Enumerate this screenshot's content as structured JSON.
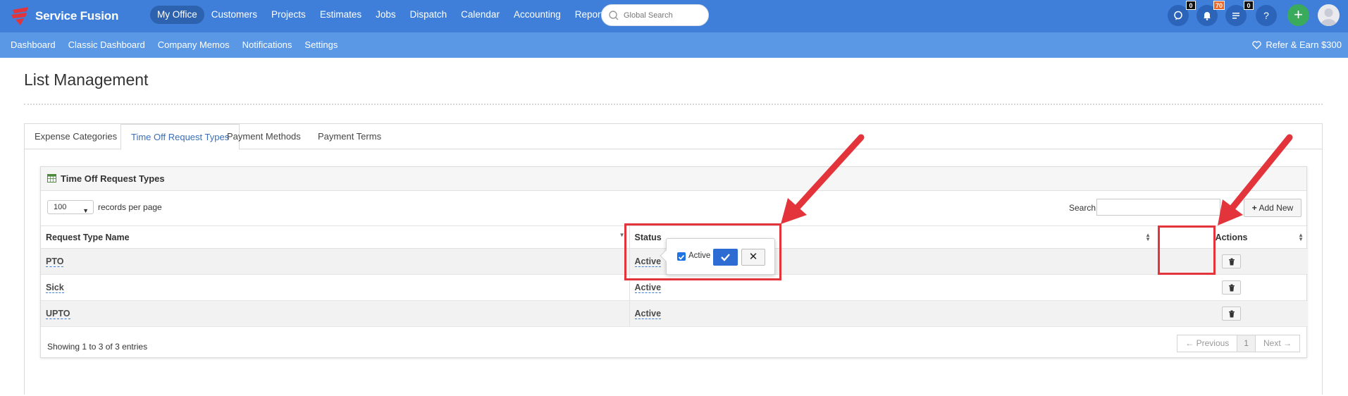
{
  "brand": {
    "name": "Service Fusion",
    "accent": "#3f7fd9",
    "logo_color": "#e4343b"
  },
  "main_nav": [
    {
      "label": "My Office",
      "active": true
    },
    {
      "label": "Customers"
    },
    {
      "label": "Projects"
    },
    {
      "label": "Estimates"
    },
    {
      "label": "Jobs"
    },
    {
      "label": "Dispatch"
    },
    {
      "label": "Calendar"
    },
    {
      "label": "Accounting"
    },
    {
      "label": "Reports"
    }
  ],
  "global_search": {
    "placeholder": "Global Search"
  },
  "top_icons": {
    "chat_badge": "0",
    "bell_badge": "70",
    "tasks_badge": "0",
    "help": "?",
    "plus": "+"
  },
  "sub_nav": [
    {
      "label": "Dashboard"
    },
    {
      "label": "Classic Dashboard"
    },
    {
      "label": "Company Memos"
    },
    {
      "label": "Notifications"
    },
    {
      "label": "Settings"
    }
  ],
  "refer": {
    "label": "Refer & Earn $300"
  },
  "page": {
    "title": "List Management"
  },
  "tabs": [
    {
      "label": "Expense Categories"
    },
    {
      "label": "Time Off Request Types",
      "active": true
    },
    {
      "label": "Payment Methods"
    },
    {
      "label": "Payment Terms"
    }
  ],
  "box": {
    "title": "Time Off Request Types",
    "records_per_page": {
      "value": "100",
      "label": "records per page"
    },
    "search_label": "Search:",
    "add_new_label": "Add New",
    "columns": [
      "Request Type Name",
      "Status",
      "Actions"
    ],
    "rows": [
      {
        "name": "PTO",
        "status": "Active"
      },
      {
        "name": "Sick",
        "status": "Active"
      },
      {
        "name": "UPTO",
        "status": "Active"
      }
    ],
    "footer_info": "Showing 1 to 3 of 3 entries",
    "pager": {
      "prev": "← Previous",
      "current": "1",
      "next": "Next →"
    }
  },
  "popover": {
    "checkbox_label": "Active",
    "checked": true
  }
}
